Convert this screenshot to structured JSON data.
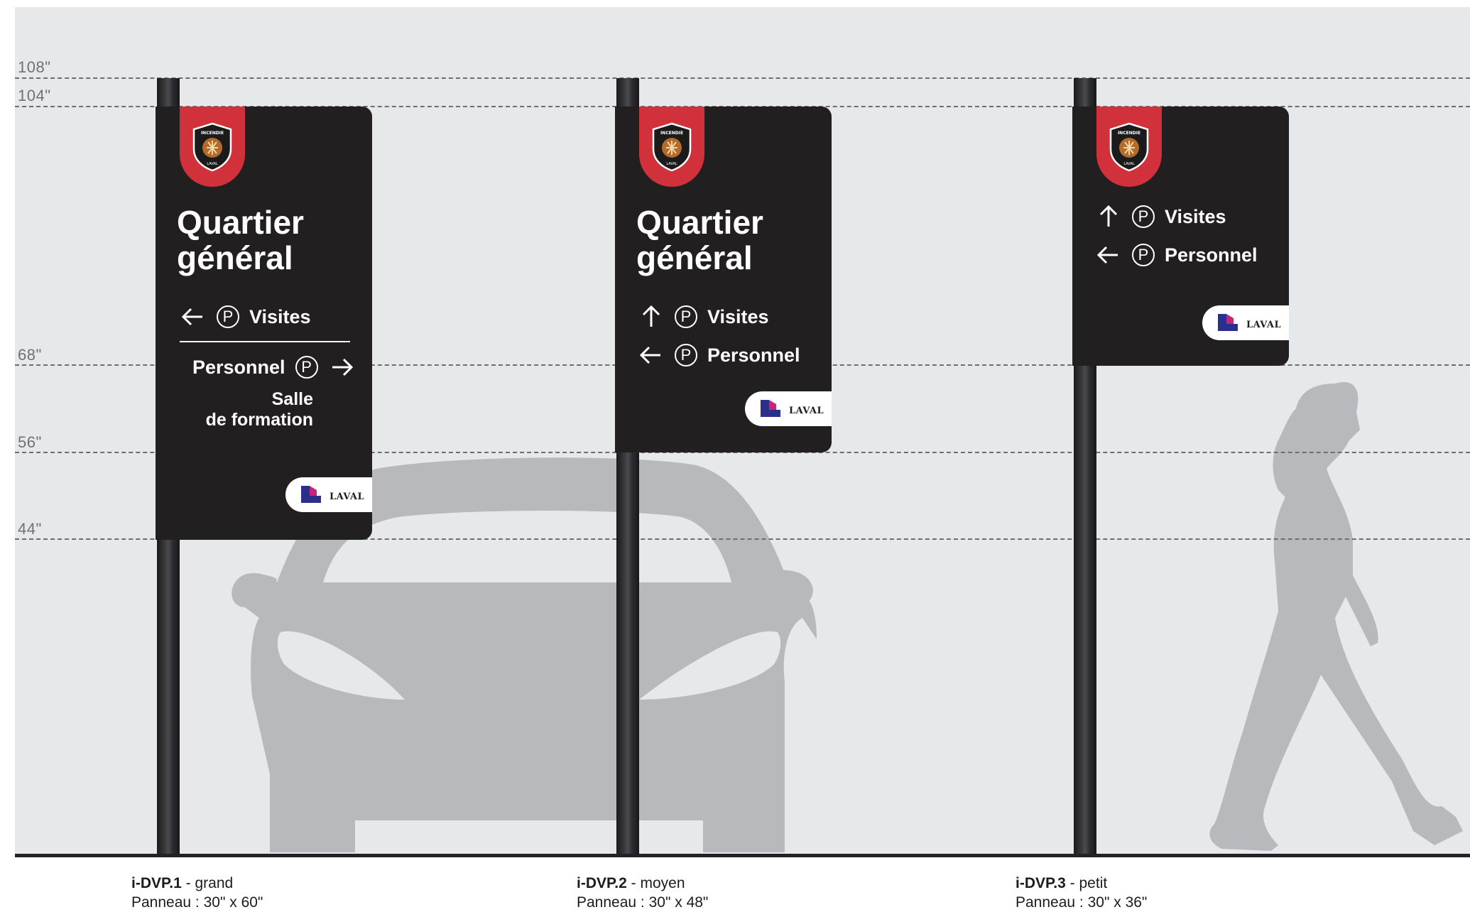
{
  "height_marks": [
    {
      "label": "108\""
    },
    {
      "label": "104\""
    },
    {
      "label": "68\""
    },
    {
      "label": "56\""
    },
    {
      "label": "44\""
    }
  ],
  "signs": [
    {
      "title_line1": "Quartier",
      "title_line2": "général",
      "visites": "Visites",
      "personnel": "Personnel",
      "subtext_line1": "Salle",
      "subtext_line2": "de formation",
      "logo_text": "LAVAL",
      "code": "i-DVP.1",
      "size_name": "- grand",
      "panel_label": "Panneau : 30\" x 60\""
    },
    {
      "title_line1": "Quartier",
      "title_line2": "général",
      "visites": "Visites",
      "personnel": "Personnel",
      "logo_text": "LAVAL",
      "code": "i-DVP.2",
      "size_name": "- moyen",
      "panel_label": "Panneau : 30\" x 48\""
    },
    {
      "visites": "Visites",
      "personnel": "Personnel",
      "logo_text": "LAVAL",
      "code": "i-DVP.3",
      "size_name": "- petit",
      "panel_label": "Panneau : 30\" x 36\""
    }
  ],
  "colors": {
    "panel": "#221f20",
    "accent_red": "#d0313a",
    "silhouette": "#b8b9bd",
    "background": "#e7e8ea"
  },
  "icons": [
    "arrow-left-icon",
    "arrow-right-icon",
    "arrow-up-icon",
    "parking-icon",
    "fire-department-crest-icon",
    "laval-logo-icon",
    "car-silhouette",
    "walking-person-silhouette"
  ]
}
